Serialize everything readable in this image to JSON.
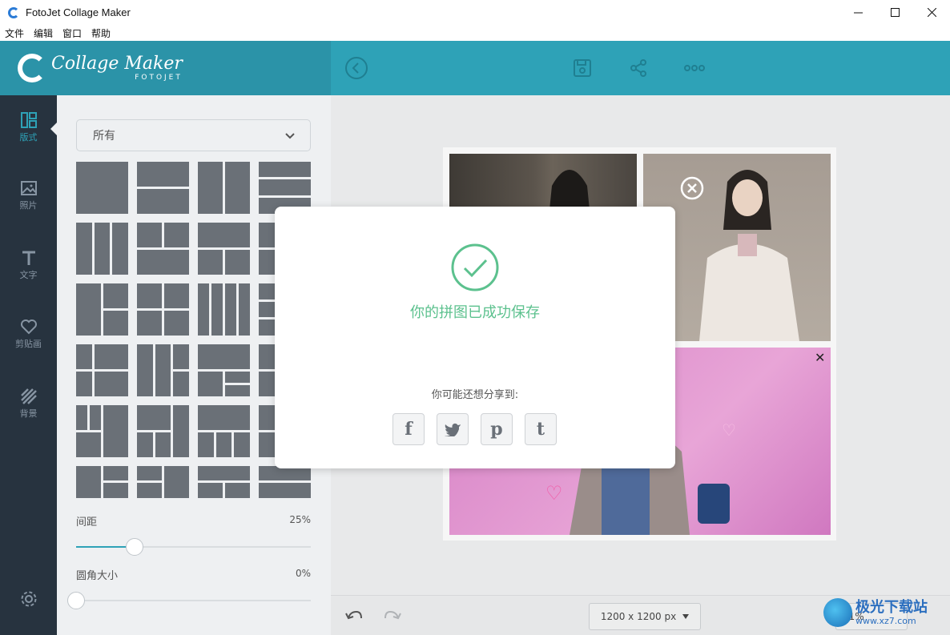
{
  "window": {
    "title": "FotoJet Collage Maker",
    "controls": [
      "minimize",
      "maximize",
      "close"
    ]
  },
  "menu": [
    "文件",
    "编辑",
    "窗口",
    "帮助"
  ],
  "header": {
    "logo_main": "Collage Maker",
    "logo_sub": "FOTOJET",
    "icons": [
      "back-icon",
      "save-icon",
      "share-icon",
      "more-icon"
    ]
  },
  "sidebar": {
    "items": [
      {
        "label": "版式",
        "icon": "layout-icon",
        "active": true
      },
      {
        "label": "照片",
        "icon": "photo-icon",
        "active": false
      },
      {
        "label": "文字",
        "icon": "text-icon",
        "active": false
      },
      {
        "label": "剪贴画",
        "icon": "heart-icon",
        "active": false
      },
      {
        "label": "背景",
        "icon": "background-icon",
        "active": false
      }
    ],
    "settings_icon": "gear-icon"
  },
  "panel": {
    "filter_value": "所有",
    "spacing": {
      "label": "间距",
      "value": "25%",
      "fraction": 0.25
    },
    "corner": {
      "label": "圆角大小",
      "value": "0%",
      "fraction": 0.0
    }
  },
  "bottom": {
    "size_value": "1200 x 1200 px",
    "zoom_value": "41%"
  },
  "modal": {
    "title": "你的拼图已成功保存",
    "share_label": "你可能还想分享到:",
    "share_buttons": [
      {
        "name": "facebook",
        "glyph": "f"
      },
      {
        "name": "twitter",
        "glyph": "t"
      },
      {
        "name": "pinterest",
        "glyph": "p"
      },
      {
        "name": "tumblr",
        "glyph": "t"
      }
    ]
  },
  "watermark": {
    "text": "极光下载站",
    "url": "www.xz7.com"
  },
  "colors": {
    "accent": "#2ea2b7",
    "success": "#5cc18e",
    "sidebar_bg": "#27333f"
  }
}
